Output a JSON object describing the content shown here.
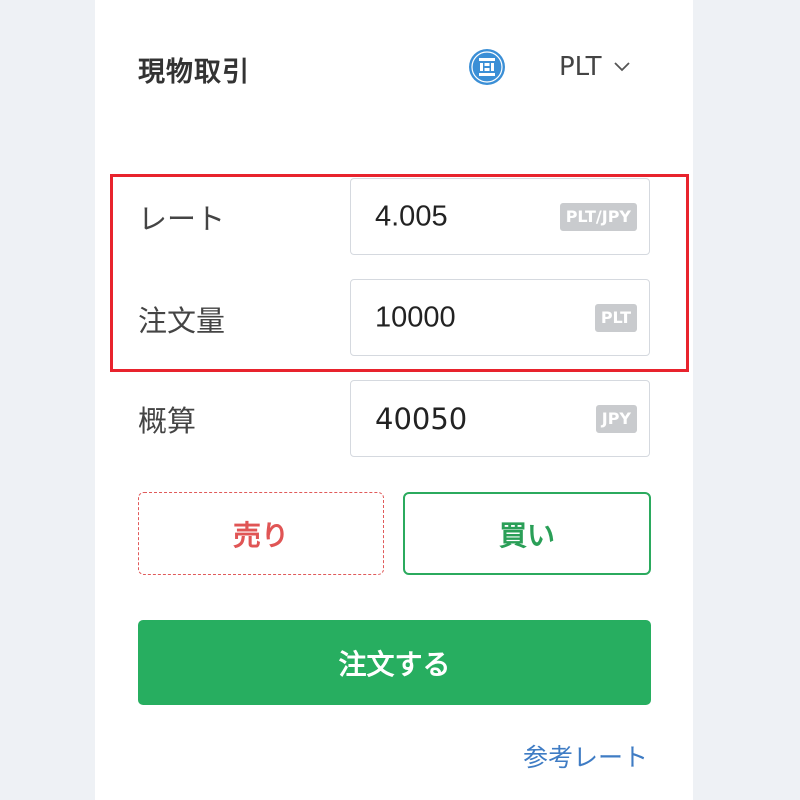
{
  "header": {
    "title": "現物取引",
    "pair": "PLT",
    "coin_icon": "platinum-coin-icon",
    "dropdown_icon": "chevron-down-icon"
  },
  "form": {
    "rate": {
      "label": "レート",
      "value": "4.005",
      "unit": "PLT/JPY"
    },
    "amount": {
      "label": "注文量",
      "value": "10000",
      "unit": "PLT"
    },
    "estimate": {
      "label": "概算",
      "value": "40050",
      "unit": "JPY"
    }
  },
  "actions": {
    "sell_label": "売り",
    "buy_label": "買い",
    "order_label": "注文する"
  },
  "footer": {
    "reference_rate_link": "参考レート"
  },
  "colors": {
    "accent_green": "#27ae60",
    "sell_red": "#e05555",
    "highlight_red": "#e8232d",
    "link_blue": "#3f7cc4",
    "coin_blue": "#3b8fd6"
  }
}
